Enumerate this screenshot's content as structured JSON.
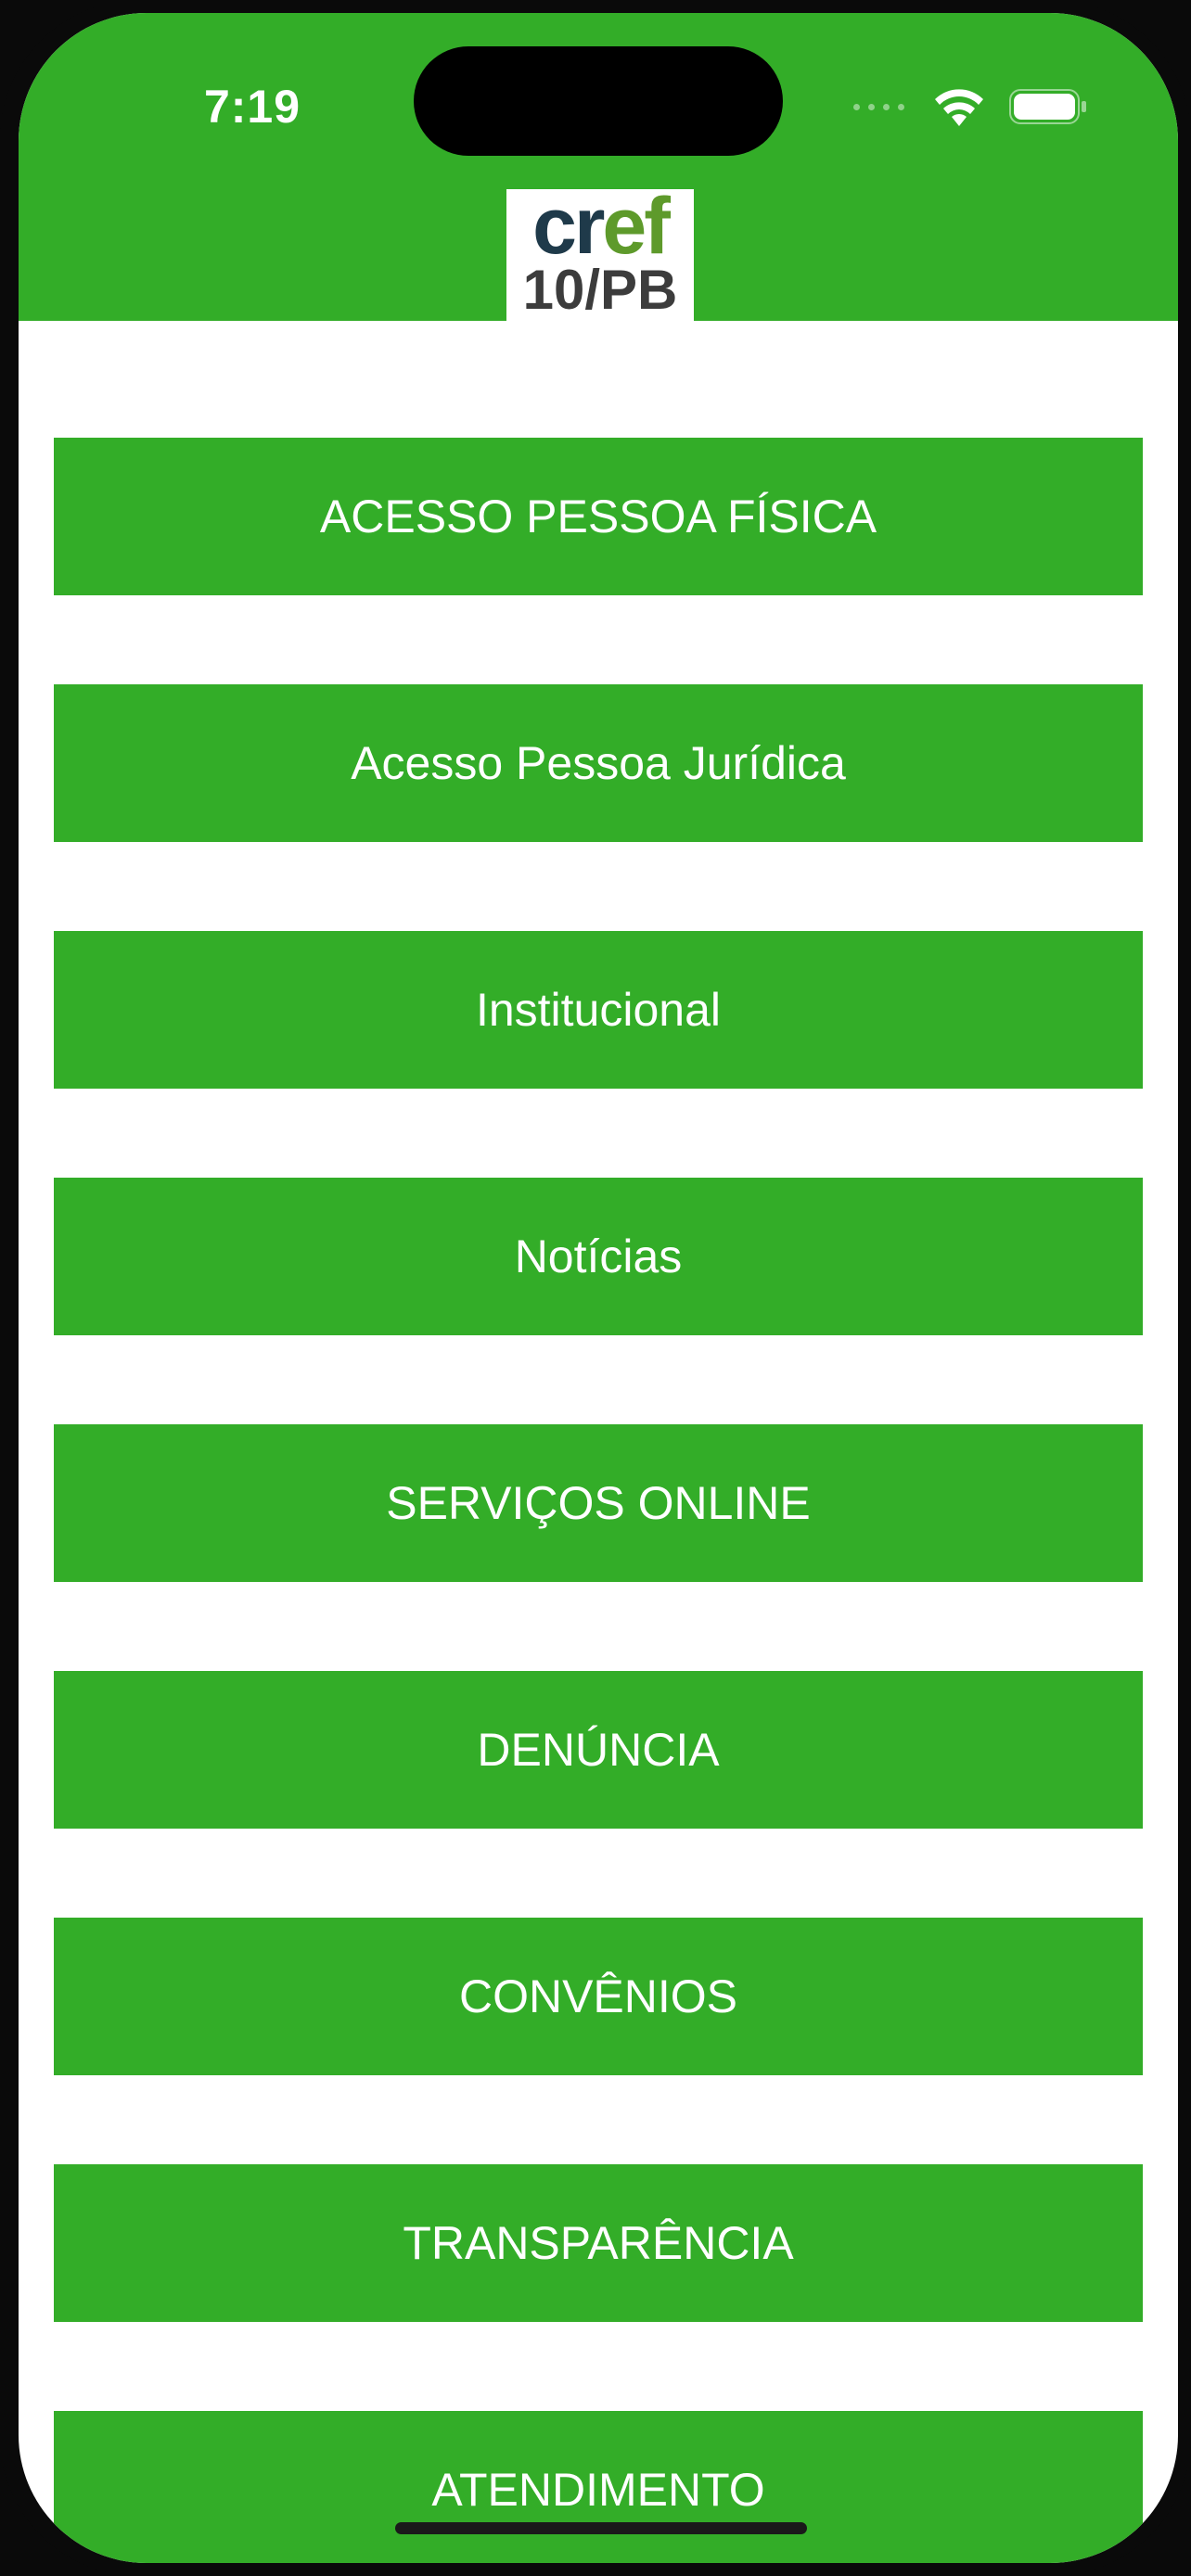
{
  "status_bar": {
    "time": "7:19",
    "wifi_icon": "wifi-icon",
    "battery_icon": "battery-icon",
    "signal_icon": "cellular-signal-icon"
  },
  "header": {
    "logo": {
      "word_dark": "cr",
      "word_green": "ef",
      "subtitle": "10/PB"
    }
  },
  "menu": {
    "items": [
      {
        "label": "ACESSO PESSOA FÍSICA"
      },
      {
        "label": "Acesso Pessoa Jurídica"
      },
      {
        "label": "Institucional"
      },
      {
        "label": "Notícias"
      },
      {
        "label": "SERVIÇOS ONLINE"
      },
      {
        "label": "DENÚNCIA"
      },
      {
        "label": "CONVÊNIOS"
      },
      {
        "label": "TRANSPARÊNCIA"
      },
      {
        "label": "ATENDIMENTO"
      }
    ]
  },
  "colors": {
    "brand_green": "#33ad28",
    "logo_dark": "#1f3a4a",
    "logo_green": "#5e9a2b",
    "background": "#ffffff"
  }
}
